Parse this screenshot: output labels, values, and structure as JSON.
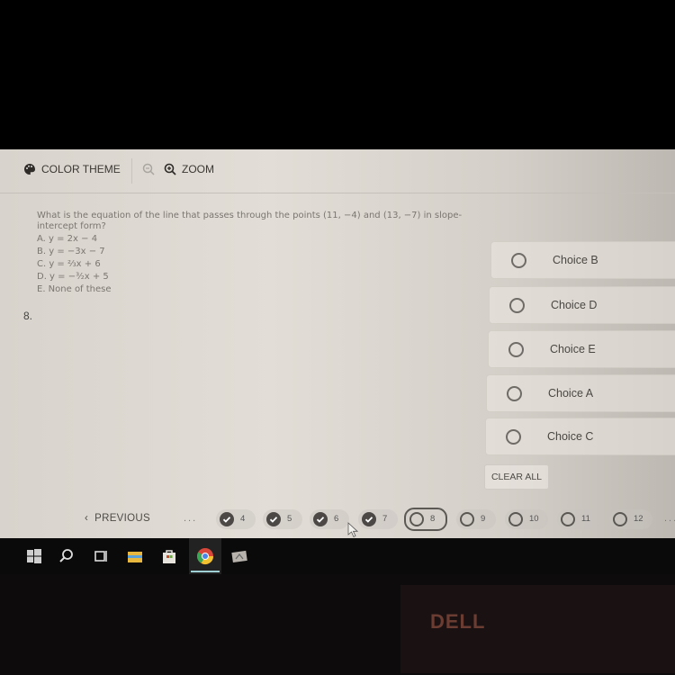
{
  "toolbar": {
    "color_theme_label": "COLOR THEME",
    "zoom_label": "ZOOM",
    "icons": [
      "palette-icon",
      "zoom-out-icon",
      "zoom-in-icon"
    ]
  },
  "question": {
    "number": "8.",
    "text": "What is the equation of the line that passes through the points (11, −4) and (13, −7) in slope-intercept form?",
    "options": [
      "A. y = 2x − 4",
      "B. y = −3x − 7",
      "C. y = ⅔x + 6",
      "D. y = −³⁄₂x + 5",
      "E. None of these"
    ]
  },
  "choices": [
    {
      "label": "Choice B",
      "selected": false
    },
    {
      "label": "Choice D",
      "selected": false
    },
    {
      "label": "Choice E",
      "selected": false
    },
    {
      "label": "Choice A",
      "selected": false
    },
    {
      "label": "Choice C",
      "selected": false
    }
  ],
  "clear_all_label": "CLEAR ALL",
  "navigation": {
    "previous_label": "PREVIOUS",
    "ellipsis": "...",
    "questions": [
      {
        "num": "4",
        "answered": true,
        "current": false
      },
      {
        "num": "5",
        "answered": true,
        "current": false
      },
      {
        "num": "6",
        "answered": true,
        "current": false
      },
      {
        "num": "7",
        "answered": true,
        "current": false
      },
      {
        "num": "8",
        "answered": false,
        "current": true
      },
      {
        "num": "9",
        "answered": false,
        "current": false
      },
      {
        "num": "10",
        "answered": false,
        "current": false
      },
      {
        "num": "11",
        "answered": false,
        "current": false
      },
      {
        "num": "12",
        "answered": false,
        "current": false
      }
    ]
  },
  "taskbar": {
    "icons": [
      "windows-start-icon",
      "search-icon",
      "task-view-icon",
      "file-explorer-icon",
      "store-icon",
      "chrome-icon",
      "app-icon"
    ]
  },
  "bezel": {
    "brand": "DELL"
  }
}
